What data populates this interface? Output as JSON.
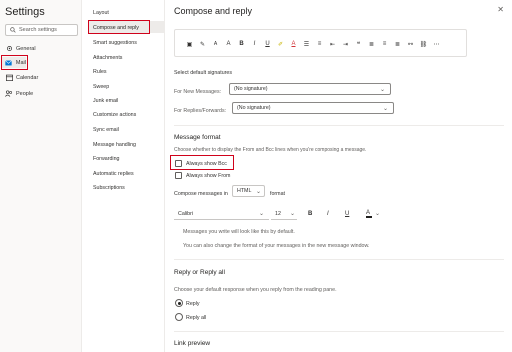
{
  "settings": {
    "title": "Settings",
    "search_placeholder": "Search settings",
    "nav": [
      {
        "label": "General",
        "icon": "gear-icon"
      },
      {
        "label": "Mail",
        "icon": "mail-icon"
      },
      {
        "label": "Calendar",
        "icon": "calendar-icon"
      },
      {
        "label": "People",
        "icon": "people-icon"
      }
    ]
  },
  "mail_menu": [
    "Layout",
    "Compose and reply",
    "Smart suggestions",
    "Attachments",
    "Rules",
    "Sweep",
    "Junk email",
    "Customize actions",
    "Sync email",
    "Message handling",
    "Forwarding",
    "Automatic replies",
    "Subscriptions"
  ],
  "pane": {
    "title": "Compose and reply",
    "close": "✕",
    "signatures": {
      "heading": "Select default signatures",
      "new_label": "For New Messages:",
      "new_value": "(No signature)",
      "reply_label": "For Replies/Forwards:",
      "reply_value": "(No signature)"
    },
    "message_format": {
      "heading": "Message format",
      "desc": "Choose whether to display the From and Bcc lines when you're composing a message.",
      "always_bcc": "Always show Bcc",
      "always_from": "Always show From",
      "compose_in": "Compose messages in",
      "format_value": "HTML",
      "format_suffix": "format",
      "font_name": "Calibri",
      "font_size": "12",
      "note1": "Messages you write will look like this by default.",
      "note2": "You can also change the format of your messages in the new message window."
    },
    "reply": {
      "heading": "Reply or Reply all",
      "desc": "Choose your default response when you reply from the reading pane.",
      "opt1": "Reply",
      "opt2": "Reply all"
    },
    "link_preview": "Link preview"
  },
  "colors": {
    "accent": "#0078d4",
    "highlight_box": "#d0021b"
  }
}
